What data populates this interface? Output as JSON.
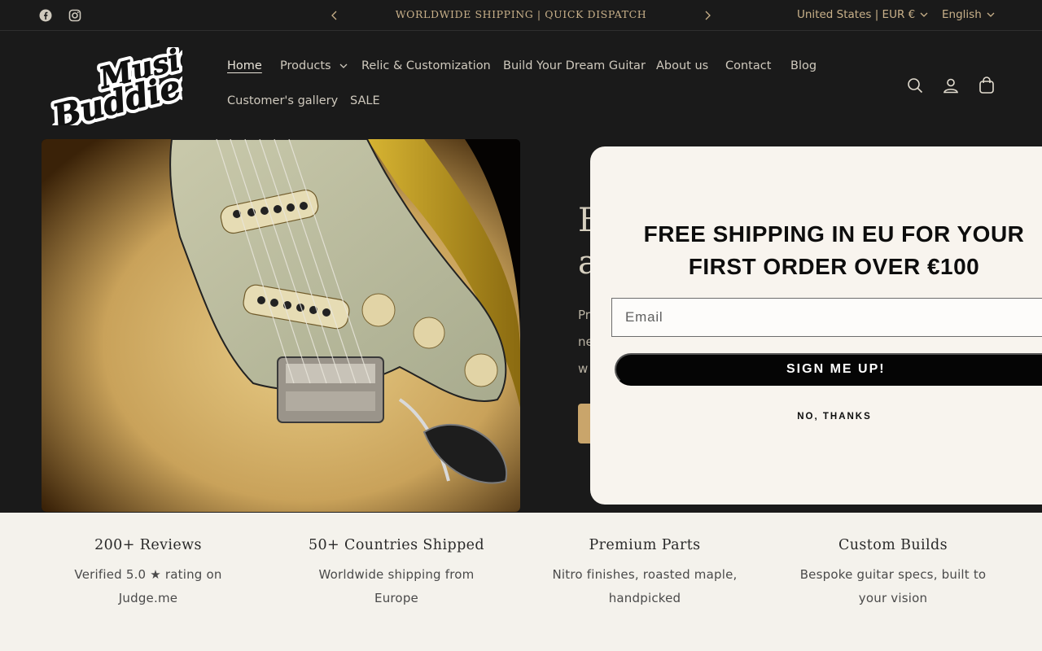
{
  "announcement": {
    "text": "WORLDWIDE SHIPPING | QUICK DISPATCH",
    "prev_icon": "chevron-left-icon",
    "next_icon": "chevron-right-icon"
  },
  "social": {
    "facebook_icon": "facebook-icon",
    "instagram_icon": "instagram-icon"
  },
  "locale": {
    "country": "United States | EUR €",
    "language": "English"
  },
  "logo": {
    "line1": "Music",
    "line2": "Buddies"
  },
  "nav": {
    "items": [
      {
        "label": "Home",
        "active": true
      },
      {
        "label": "Products",
        "dropdown": true
      },
      {
        "label": "Relic & Customization"
      },
      {
        "label": "Build Your Dream Guitar"
      },
      {
        "label": "About us"
      },
      {
        "label": "Contact"
      },
      {
        "label": "Blog"
      },
      {
        "label": "Customer's gallery"
      },
      {
        "label": "SALE"
      }
    ]
  },
  "header_icons": [
    "search-icon",
    "account-icon",
    "cart-icon"
  ],
  "hero": {
    "heading_line1": "B",
    "heading_line2": "a",
    "body_line1": "Pr",
    "body_line2": "ne",
    "body_line3": "w"
  },
  "popup": {
    "title_line1": "FREE SHIPPING IN EU FOR YOUR",
    "title_line2": "FIRST ORDER OVER €100",
    "email_placeholder": "Email",
    "signup_label": "SIGN ME UP!",
    "decline_label": "NO, THANKS"
  },
  "features": [
    {
      "title": "200+ Reviews",
      "line1": "Verified 5.0 ★ rating on",
      "line2": "Judge.me"
    },
    {
      "title": "50+ Countries Shipped",
      "line1": "Worldwide shipping from",
      "line2": "Europe"
    },
    {
      "title": "Premium Parts",
      "line1": "Nitro finishes, roasted maple,",
      "line2": "handpicked"
    },
    {
      "title": "Custom Builds",
      "line1": "Bespoke guitar specs, built to",
      "line2": "your vision"
    }
  ],
  "colors": {
    "background": "#1a1a1a",
    "accent_gold": "#c9a56b",
    "popup_bg": "#f8f4ee",
    "features_bg": "#f4f2ec"
  }
}
